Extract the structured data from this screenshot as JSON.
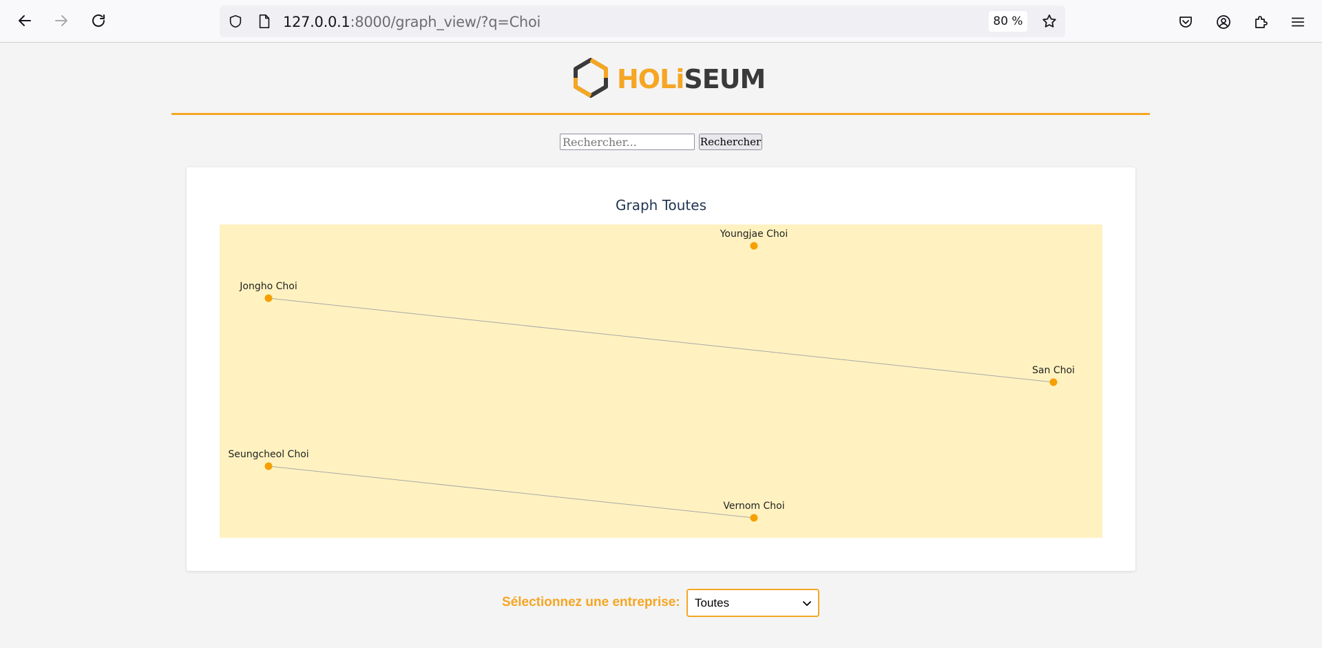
{
  "browser": {
    "url_host": "127.0.0.1",
    "url_rest": ":8000/graph_view/?q=Choi",
    "zoom": "80 %"
  },
  "logo": {
    "part1": "HOLi",
    "part2": "S",
    "part3": "EUM"
  },
  "search": {
    "placeholder": "Rechercher...",
    "button_label": "Rechercher"
  },
  "graph": {
    "title": "Graph Toutes",
    "nodes": [
      {
        "id": "youngjae",
        "label": "Youngjae Choi"
      },
      {
        "id": "jongho",
        "label": "Jongho Choi"
      },
      {
        "id": "san",
        "label": "San Choi"
      },
      {
        "id": "seungcheol",
        "label": "Seungcheol Choi"
      },
      {
        "id": "vernom",
        "label": "Vernom Choi"
      }
    ],
    "edges": [
      {
        "from": "jongho",
        "to": "san"
      },
      {
        "from": "seungcheol",
        "to": "vernom"
      }
    ],
    "node_color": "#f5a000",
    "edge_color": "#a8a8a8"
  },
  "company_select": {
    "label": "Sélectionnez une entreprise:",
    "selected": "Toutes"
  },
  "colors": {
    "accent": "#f5a623",
    "graph_bg": "#fff2c0"
  }
}
